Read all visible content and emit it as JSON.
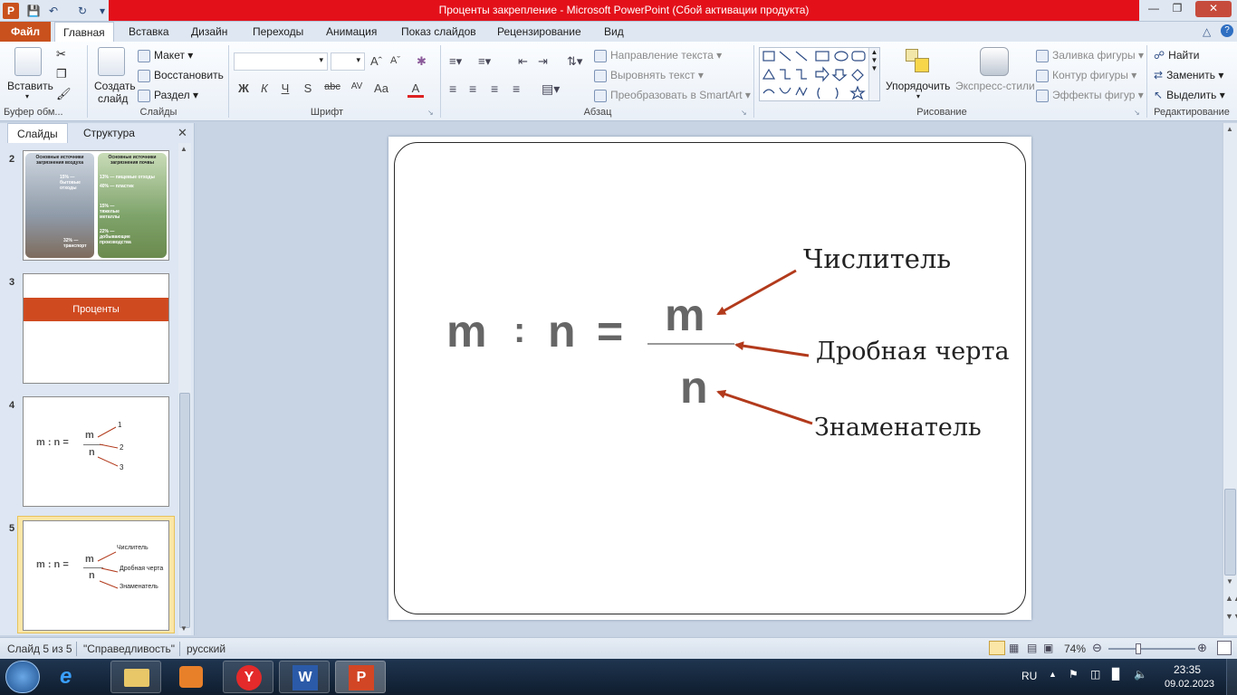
{
  "window": {
    "title": "Проценты закрепление  -  Microsoft PowerPoint (Сбой активации продукта)"
  },
  "tabs": [
    "Файл",
    "Главная",
    "Вставка",
    "Дизайн",
    "Переходы",
    "Анимация",
    "Показ слайдов",
    "Рецензирование",
    "Вид"
  ],
  "ribbon": {
    "clipboard": {
      "paste": "Вставить",
      "label": "Буфер обм..."
    },
    "slides": {
      "create": "Создать",
      "create2": "слайд",
      "layout": "Макет",
      "reset": "Восстановить",
      "section": "Раздел",
      "label": "Слайды"
    },
    "font": {
      "label": "Шрифт",
      "bold": "Ж",
      "italic": "К",
      "underline": "Ч",
      "shadow": "S",
      "strike": "abc",
      "spacing": "AV",
      "case": "Aa",
      "color": "A"
    },
    "paragraph": {
      "label": "Абзац",
      "text_direction": "Направление текста",
      "align_text": "Выровнять текст",
      "smartart": "Преобразовать в SmartArt"
    },
    "drawing": {
      "arrange": "Упорядочить",
      "quick_styles": "Экспресс-стили",
      "fill": "Заливка фигуры",
      "outline": "Контур фигуры",
      "effects": "Эффекты фигур",
      "label": "Рисование"
    },
    "editing": {
      "find": "Найти",
      "replace": "Заменить",
      "select": "Выделить",
      "label": "Редактирование"
    }
  },
  "pane": {
    "tab_slides": "Слайды",
    "tab_outline": "Структура"
  },
  "thumbs": [
    {
      "num": "2",
      "t1": "Основные источники загрязнения воздуха",
      "t2": "Основные источники загрязнения почвы",
      "p1": "15% — бытовые отходы",
      "p2": "32% — транспорт",
      "p3": "13% — пищевые отходы",
      "p4": "40% — пластик",
      "p5": "15% — тяжелые металлы",
      "p6": "22% — добывающие производства"
    },
    {
      "num": "3",
      "banner": "Проценты"
    },
    {
      "num": "4",
      "formula": "m : n =",
      "m": "m",
      "n": "n",
      "l1": "1",
      "l2": "2",
      "l3": "3"
    },
    {
      "num": "5",
      "formula": "m : n =",
      "m": "m",
      "n": "n",
      "l1": "Числитель",
      "l2": "Дробная черта",
      "l3": "Знаменатель"
    }
  ],
  "slide": {
    "lhs_m": "m",
    "colon": ":",
    "lhs_n": "n",
    "eq": "=",
    "num": "m",
    "den": "n",
    "label_num": "Числитель",
    "label_bar": "Дробная черта",
    "label_den": "Знаменатель",
    "arrow_color": "#b23a1c"
  },
  "status": {
    "slide": "Слайд 5 из 5",
    "theme": "\"Справедливость\"",
    "lang": "русский",
    "zoom": "74%"
  },
  "tray": {
    "lang": "RU",
    "time": "23:35",
    "date": "09.02.2023"
  }
}
